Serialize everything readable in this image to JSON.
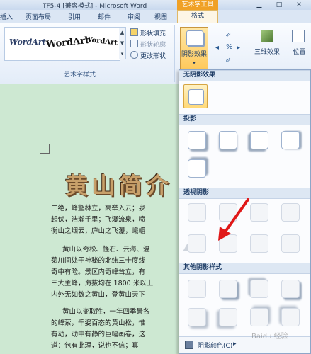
{
  "window": {
    "title": "TF5-4 [兼容模式] - Microsoft Word",
    "context_tab_group": "艺术字工具"
  },
  "tabs": [
    "插入",
    "页面布局",
    "引用",
    "邮件",
    "审阅",
    "视图",
    "格式"
  ],
  "ribbon": {
    "wordart_styles": [
      "WordArt",
      "WordArt",
      "WordArt"
    ],
    "shape_fill": "形状填充",
    "shape_outline": "形状轮廓",
    "change_shape": "更改形状",
    "group_label": "艺术字样式",
    "shadow_effect": "阴影效果",
    "three_d": "三维效果",
    "position": "位置"
  },
  "document": {
    "heading": "黄山简介",
    "paragraphs": [
      "二绝，峰壑林立，高举入云；泉",
      "起伏，浩瀚千里；飞瀑流泉，喷",
      "衡山之烟云，庐山之飞瀑，峨嵋",
      "黄山以奇松、怪石、云海、温",
      "菊川间处于神秘的北纬三十度线",
      "奇中有险。景区内奇峰耸立，有",
      "三大主峰，海拔均在 1800 米以上",
      "内外无如数之黄山，登黄山天下",
      "黄山以变取胜，一年四季景各",
      "的峰萦，千姿百态的黄山松，惟",
      "有动，动中有静的巨幅画卷，这",
      "道：包有此理，说也不信；真"
    ]
  },
  "panel": {
    "sections": {
      "none": "无阴影效果",
      "drop": "投影",
      "perspective": "透视阴影",
      "other": "其他阴影样式"
    },
    "shadow_color": "阴影颜色(C)",
    "shadow_color_arrow": "▸"
  },
  "watermark": "Baidu 经验"
}
